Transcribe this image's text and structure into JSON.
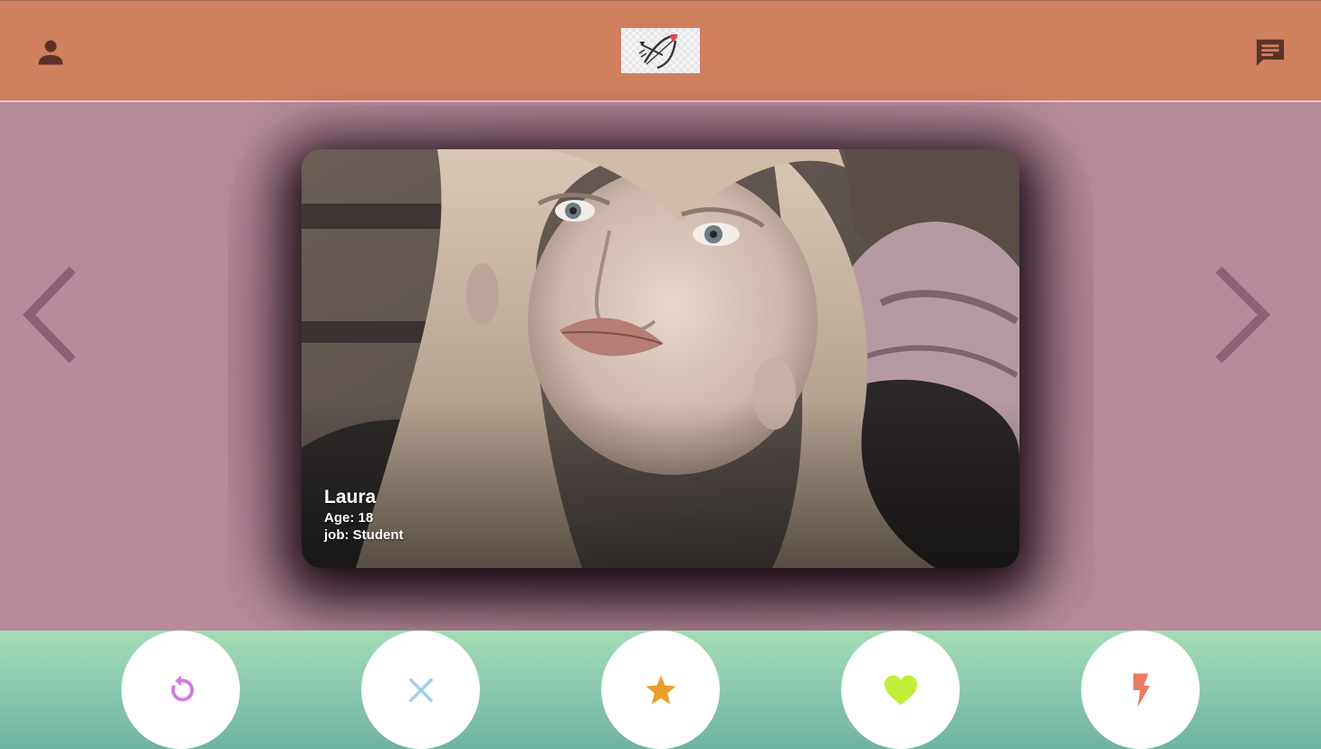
{
  "header": {
    "profile_icon": "person-icon",
    "logo_icon": "bow-and-arrow-heart-logo",
    "chat_icon": "chat-message-icon",
    "colors": {
      "background": "#d07f5f",
      "icon": "#5b3326"
    }
  },
  "stage": {
    "background": "#b88b9c",
    "prev_icon": "chevron-left-icon",
    "next_icon": "chevron-right-icon"
  },
  "profile_card": {
    "name": "Laura",
    "age_line": "Age: 18",
    "job_line": "job: Student"
  },
  "actions": [
    {
      "id": "rewind",
      "icon": "rewind-icon",
      "color": "#d37ce0"
    },
    {
      "id": "nope",
      "icon": "close-icon",
      "color": "#9fd0e8"
    },
    {
      "id": "super-like",
      "icon": "star-icon",
      "color": "#e8a02a"
    },
    {
      "id": "like",
      "icon": "heart-icon",
      "color": "#c3ee3a"
    },
    {
      "id": "boost",
      "icon": "lightning-icon",
      "color": "#e87a62"
    }
  ]
}
